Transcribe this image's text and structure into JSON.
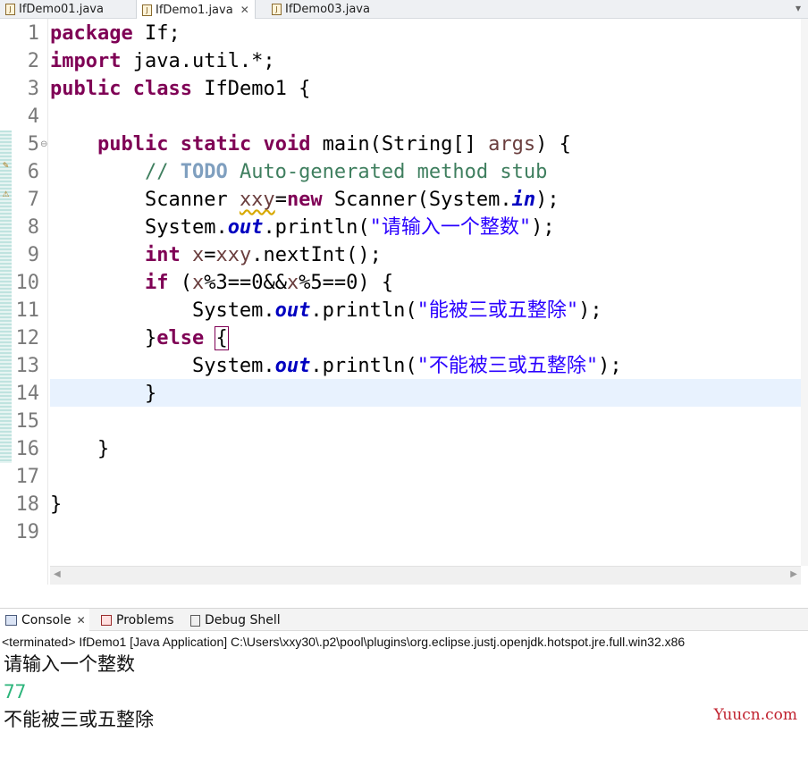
{
  "editor_tabs": [
    {
      "label": "IfDemo01.java",
      "active": false
    },
    {
      "label": "IfDemo1.java",
      "active": true
    },
    {
      "label": "IfDemo03.java",
      "active": false
    }
  ],
  "editor": {
    "line_numbers": [
      "1",
      "2",
      "3",
      "4",
      "5",
      "6",
      "7",
      "8",
      "9",
      "10",
      "11",
      "12",
      "13",
      "14",
      "15",
      "16",
      "17",
      "18",
      "19"
    ],
    "current_line": 14,
    "code": {
      "l1": {
        "kw": "package",
        "rest": " If;"
      },
      "l2": {
        "kw": "import",
        "rest": " java.util.*;"
      },
      "l3": {
        "kw1": "public",
        "kw2": "class",
        "rest": " IfDemo1 {"
      },
      "l5": {
        "indent": "    ",
        "kw1": "public",
        "kw2": "static",
        "kw3": "void",
        "mid": " main(String[] ",
        "var": "args",
        "rest": ") {"
      },
      "l6": {
        "indent": "        ",
        "comment": "// ",
        "todo": "TODO",
        "comment_rest": " Auto-generated method stub"
      },
      "l7": {
        "indent": "        ",
        "pre": "Scanner ",
        "var": "xxy",
        "eq": "=",
        "kw": "new",
        "mid": " Scanner(System.",
        "field": "in",
        "rest": ");"
      },
      "l8": {
        "indent": "        ",
        "pre": "System.",
        "field": "out",
        "mid": ".println(",
        "str": "\"请输入一个整数\"",
        "rest": ");"
      },
      "l9": {
        "indent": "        ",
        "kw": "int",
        "sp": " ",
        "var1": "x",
        "eq": "=",
        "var2": "xxy",
        "rest": ".nextInt();"
      },
      "l10": {
        "indent": "        ",
        "kw": "if",
        "p1": " (",
        "var1": "x",
        "m1": "%3==0&&",
        "var2": "x",
        "rest": "%5==0) {"
      },
      "l11": {
        "indent": "            ",
        "pre": "System.",
        "field": "out",
        "mid": ".println(",
        "str": "\"能被三或五整除\"",
        "rest": ");"
      },
      "l12": {
        "indent": "        ",
        "pre": "}",
        "kw": "else",
        "sp": " ",
        "brace": "{"
      },
      "l13": {
        "indent": "            ",
        "pre": "System.",
        "field": "out",
        "mid": ".println(",
        "str": "\"不能被三或五整除\"",
        "rest": ");"
      },
      "l14": {
        "text": "        }"
      },
      "l16": {
        "text": "    }"
      },
      "l18": {
        "text": "}"
      }
    }
  },
  "console_tabs": [
    {
      "label": "Console",
      "icon": "console-icon",
      "active": true
    },
    {
      "label": "Problems",
      "icon": "problems-icon",
      "active": false
    },
    {
      "label": "Debug Shell",
      "icon": "debug-shell-icon",
      "active": false
    }
  ],
  "console": {
    "terminated": "<terminated> IfDemo1 [Java Application] C:\\Users\\xxy30\\.p2\\pool\\plugins\\org.eclipse.justj.openjdk.hotspot.jre.full.win32.x86",
    "output": [
      {
        "text": "请输入一个整数",
        "kind": "stdout"
      },
      {
        "text": "77",
        "kind": "stdin"
      },
      {
        "text": "不能被三或五整除",
        "kind": "stdout"
      }
    ]
  },
  "watermark": "Yuucn.com",
  "colors": {
    "keyword": "#7f0055",
    "comment": "#3f7f5f",
    "string": "#2a00ff",
    "field": "#0000c0",
    "stdin": "#2bb47a",
    "current_line": "#e8f2fe",
    "watermark": "#c0212e"
  }
}
